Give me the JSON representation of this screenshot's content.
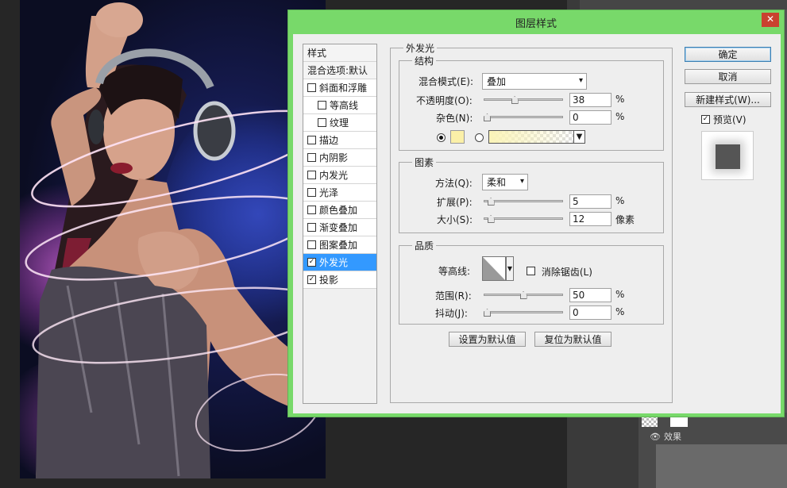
{
  "dialog": {
    "title": "图层样式",
    "close_label": "✕"
  },
  "styles_list": {
    "header": "样式",
    "blend_default": "混合选项:默认",
    "items": [
      {
        "label": "斜面和浮雕",
        "checked": false,
        "indent": false
      },
      {
        "label": "等高线",
        "checked": false,
        "indent": true
      },
      {
        "label": "纹理",
        "checked": false,
        "indent": true
      },
      {
        "label": "描边",
        "checked": false,
        "indent": false
      },
      {
        "label": "内阴影",
        "checked": false,
        "indent": false
      },
      {
        "label": "内发光",
        "checked": false,
        "indent": false
      },
      {
        "label": "光泽",
        "checked": false,
        "indent": false
      },
      {
        "label": "颜色叠加",
        "checked": false,
        "indent": false
      },
      {
        "label": "渐变叠加",
        "checked": false,
        "indent": false
      },
      {
        "label": "图案叠加",
        "checked": false,
        "indent": false
      },
      {
        "label": "外发光",
        "checked": true,
        "indent": false,
        "selected": true
      },
      {
        "label": "投影",
        "checked": true,
        "indent": false
      }
    ]
  },
  "outer_glow": {
    "title": "外发光",
    "structure": {
      "legend": "结构",
      "blend_mode_label": "混合模式(E):",
      "blend_mode_value": "叠加",
      "opacity_label": "不透明度(O):",
      "opacity_value": "38",
      "opacity_unit": "%",
      "opacity_level": 0.38,
      "noise_label": "杂色(N):",
      "noise_value": "0",
      "noise_unit": "%",
      "noise_level": 0,
      "swatch_color": "#fbf0a8"
    },
    "elements": {
      "legend": "图素",
      "technique_label": "方法(Q):",
      "technique_value": "柔和",
      "spread_label": "扩展(P):",
      "spread_value": "5",
      "spread_unit": "%",
      "spread_level": 0.05,
      "size_label": "大小(S):",
      "size_value": "12",
      "size_unit": "像素",
      "size_level": 0.05
    },
    "quality": {
      "legend": "品质",
      "contour_label": "等高线:",
      "antialias_label": "消除锯齿(L)",
      "range_label": "范围(R):",
      "range_value": "50",
      "range_unit": "%",
      "range_level": 0.5,
      "jitter_label": "抖动(J):",
      "jitter_value": "0",
      "jitter_unit": "%",
      "jitter_level": 0
    },
    "make_default_label": "设置为默认值",
    "reset_default_label": "复位为默认值"
  },
  "buttons": {
    "ok_label": "确定",
    "cancel_label": "取消",
    "new_style_label": "新建样式(W)...",
    "preview_label": "预览(V)",
    "preview_checked": true
  },
  "layers_panel": {
    "effects_label": "效果"
  }
}
